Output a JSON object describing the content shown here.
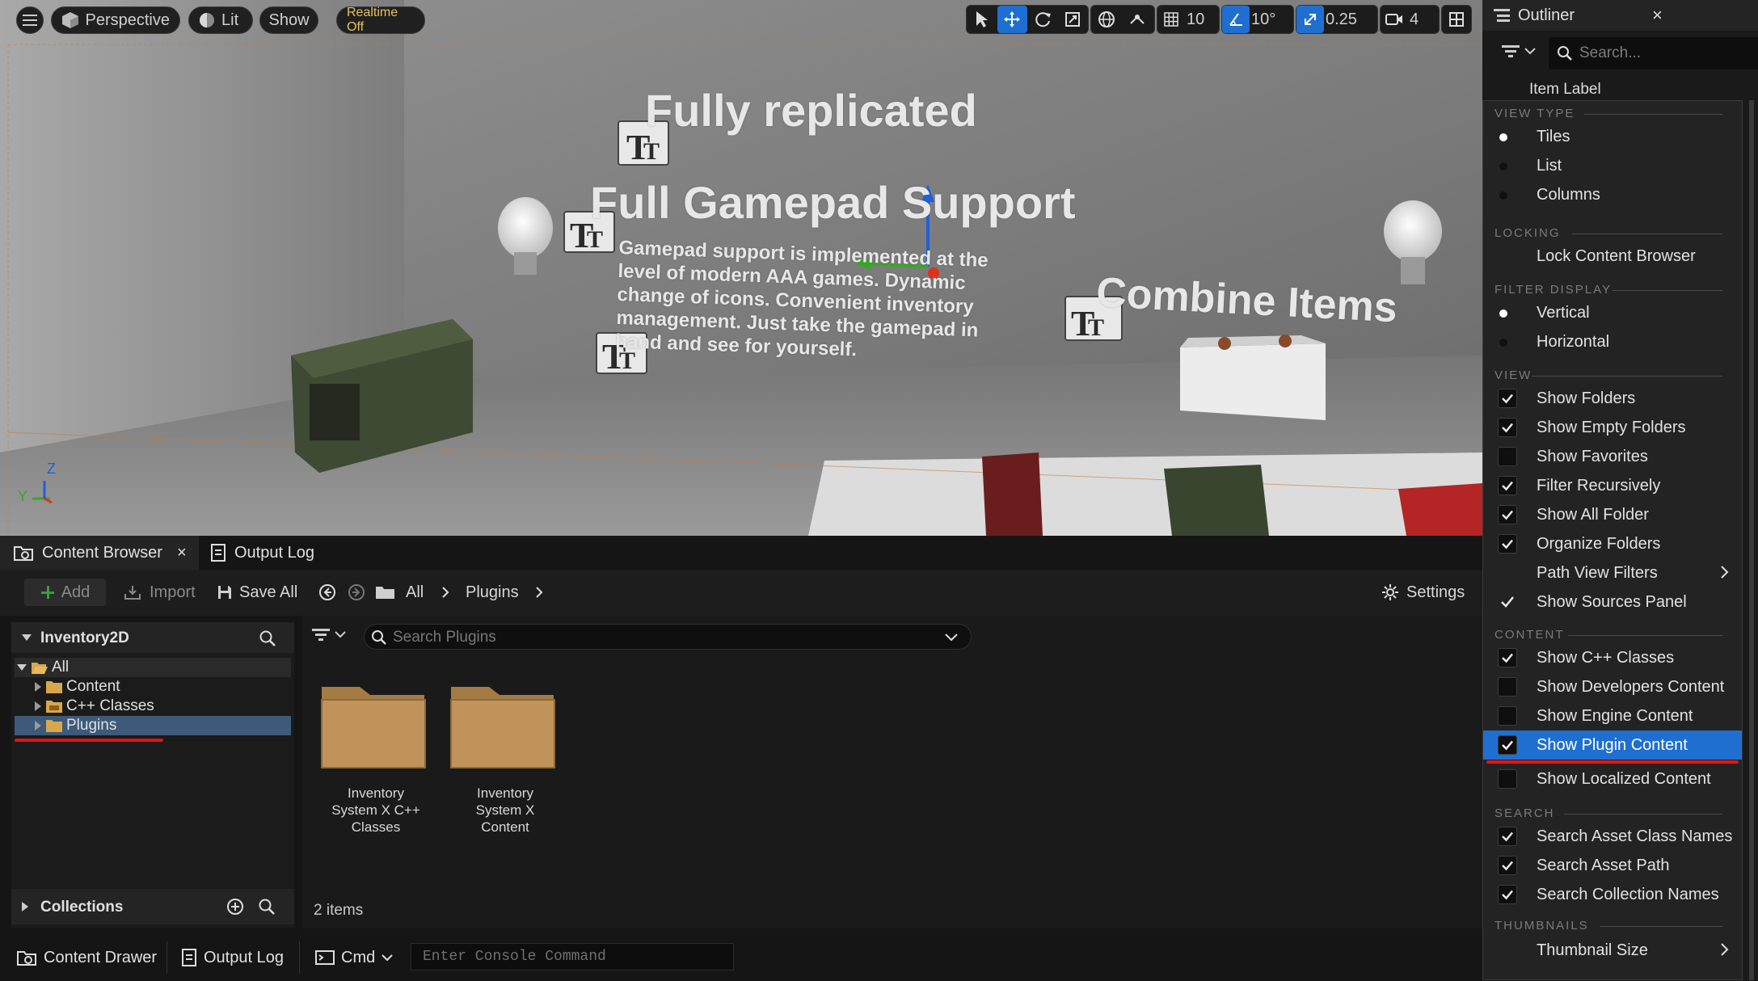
{
  "viewport": {
    "menu_icon": "hamburger-icon",
    "perspective_label": "Perspective",
    "lit_label": "Lit",
    "show_label": "Show",
    "realtime_label": "Realtime Off",
    "grid_snap_value": "10",
    "rotation_snap_value": "10°",
    "scale_snap_value": "0.25",
    "camera_speed_value": "4",
    "scene_texts": {
      "title1": "Fully replicated",
      "title2": "Full Gamepad Support",
      "title3": "Combine Items",
      "body_lines": [
        "Gamepad support is implemented at the",
        "level of modern AAA games. Dynamic",
        "change of icons. Convenient inventory",
        "management. Just take the gamepad in",
        "hand and see for yourself."
      ]
    },
    "axis": {
      "x": "Y",
      "z": "Z"
    },
    "colors": {
      "accent": "#1f6fd1",
      "realtime_text": "#e8c25a"
    }
  },
  "outliner": {
    "title": "Outliner",
    "search_placeholder": "Search...",
    "column_label": "Item Label"
  },
  "menu": {
    "sections": {
      "view_type": "VIEW TYPE",
      "locking": "LOCKING",
      "filter_display": "FILTER DISPLAY",
      "view": "VIEW",
      "content": "CONTENT",
      "search": "SEARCH",
      "thumbnails": "THUMBNAILS"
    },
    "view_type": [
      {
        "label": "Tiles",
        "selected": true
      },
      {
        "label": "List",
        "selected": false
      },
      {
        "label": "Columns",
        "selected": false
      }
    ],
    "locking": {
      "label": "Lock Content Browser"
    },
    "filter_display": [
      {
        "label": "Vertical",
        "selected": true
      },
      {
        "label": "Horizontal",
        "selected": false
      }
    ],
    "view": [
      {
        "label": "Show Folders",
        "checked": true
      },
      {
        "label": "Show Empty Folders",
        "checked": true
      },
      {
        "label": "Show Favorites",
        "checked": false
      },
      {
        "label": "Filter Recursively",
        "checked": true
      },
      {
        "label": "Show All Folder",
        "checked": true
      },
      {
        "label": "Organize Folders",
        "checked": true
      },
      {
        "label": "Path View Filters",
        "submenu": true
      },
      {
        "label": "Show Sources Panel",
        "checked": true
      }
    ],
    "content": [
      {
        "label": "Show C++ Classes",
        "checked": true
      },
      {
        "label": "Show Developers Content",
        "checked": false
      },
      {
        "label": "Show Engine Content",
        "checked": false
      },
      {
        "label": "Show Plugin Content",
        "checked": true,
        "highlighted": true
      },
      {
        "label": "Show Localized Content",
        "checked": false
      }
    ],
    "search": [
      {
        "label": "Search Asset Class Names",
        "checked": true
      },
      {
        "label": "Search Asset Path",
        "checked": true
      },
      {
        "label": "Search Collection Names",
        "checked": true
      }
    ],
    "thumbnails": {
      "label": "Thumbnail Size"
    }
  },
  "content_browser": {
    "tab_label": "Content Browser",
    "output_log_tab": "Output Log",
    "toolbar": {
      "add": "Add",
      "import": "Import",
      "save_all": "Save All",
      "breadcrumb": [
        "All",
        "Plugins"
      ],
      "settings": "Settings"
    },
    "tree": {
      "project": "Inventory2D",
      "items": [
        "All",
        "Content",
        "C++ Classes",
        "Plugins"
      ],
      "collections": "Collections"
    },
    "search_placeholder": "Search Plugins",
    "folders": [
      {
        "line1": "Inventory",
        "line2": "System X C++",
        "line3": "Classes"
      },
      {
        "line1": "Inventory",
        "line2": "System X",
        "line3": "Content"
      }
    ],
    "item_count": "2 items"
  },
  "statusbar": {
    "content_drawer": "Content Drawer",
    "output_log": "Output Log",
    "cmd": "Cmd",
    "console_placeholder": "Enter Console Command"
  },
  "annotation_color": "#e01515"
}
